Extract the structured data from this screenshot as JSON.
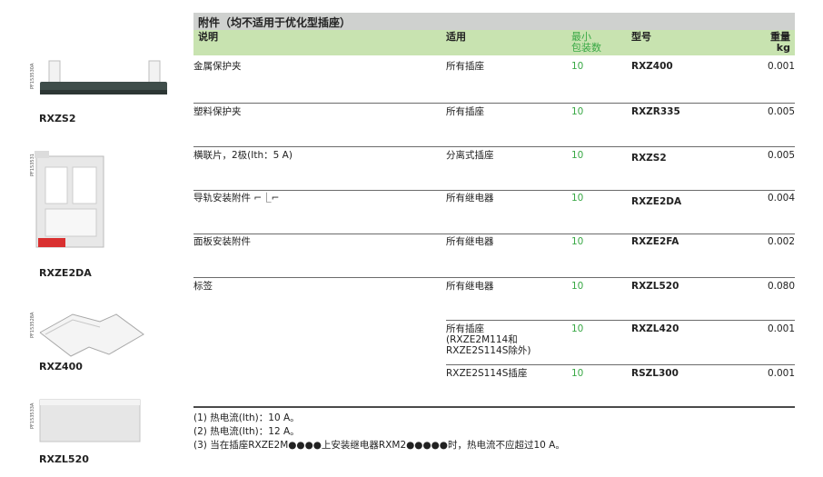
{
  "table": {
    "title": "附件（均不适用于优化型插座）",
    "headers": {
      "desc": "说明",
      "applies": "适用",
      "minpack": "最小\n包装数",
      "model": "型号",
      "weight": "重量\nkg"
    },
    "rows": [
      {
        "desc": "金属保护夹",
        "applies": "所有插座",
        "minpack": "10",
        "model": "RXZ400",
        "weight": "0.001"
      },
      {
        "desc": "塑料保护夹",
        "applies": "所有插座",
        "minpack": "10",
        "model": "RXZR335",
        "weight": "0.005"
      },
      {
        "desc": "横联片，2极(Ith：5 A)",
        "applies": "分离式插座",
        "minpack": "10",
        "model": "RXZS2",
        "weight": "0.005"
      },
      {
        "desc": "导轨安装附件 ⌐⎿⌐",
        "applies": "所有继电器",
        "minpack": "10",
        "model": "RXZE2DA",
        "weight": "0.004"
      },
      {
        "desc": "面板安装附件",
        "applies": "所有继电器",
        "minpack": "10",
        "model": "RXZE2FA",
        "weight": "0.002"
      },
      {
        "desc": "标签",
        "applies": "所有继电器",
        "minpack": "10",
        "model": "RXZL520",
        "weight": "0.080"
      },
      {
        "desc": "",
        "applies": "所有插座\n(RXZE2M114和\nRXZE2S114S除外)",
        "minpack": "10",
        "model": "RXZL420",
        "weight": "0.001"
      },
      {
        "desc": "",
        "applies": "RXZE2S114S插座",
        "minpack": "10",
        "model": "RSZL300",
        "weight": "0.001"
      }
    ]
  },
  "notes": [
    "(1) 热电流(Ith)：10 A。",
    "(2) 热电流(Ith)：12 A。",
    "(3) 当在插座RXZE2M●●●●上安装继电器RXM2●●●●●时，热电流不应超过10 A。"
  ],
  "images": [
    {
      "label": "RXZS2",
      "code": "PF153530A"
    },
    {
      "label": "RXZE2DA",
      "code": "PF153531"
    },
    {
      "label": "RXZ400",
      "code": "PF153528A"
    },
    {
      "label": "RXZL520",
      "code": "PF153533A"
    }
  ]
}
